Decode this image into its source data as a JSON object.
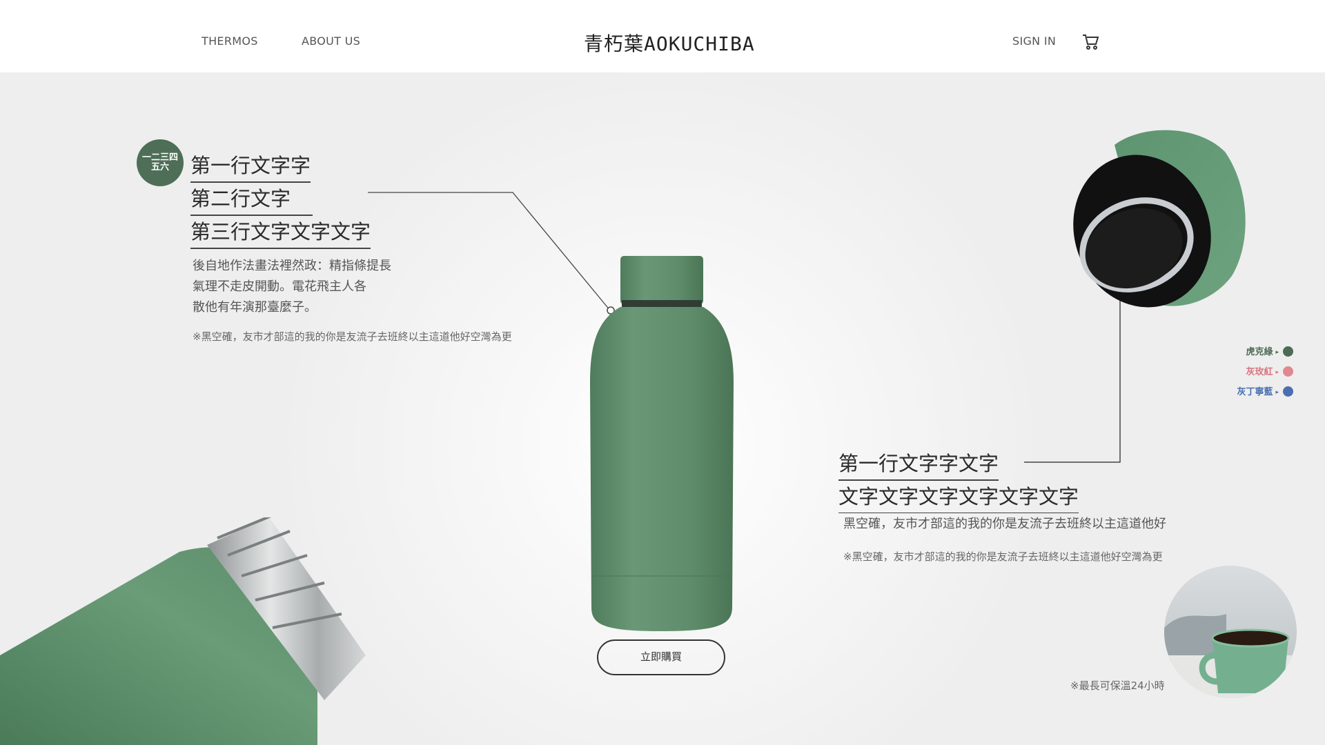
{
  "header": {
    "nav_thermos": "THERMOS",
    "nav_about": "ABOUT US",
    "logo": "青朽葉AOKUCHIBA",
    "sign_in": "SIGN IN",
    "cart_icon": "cart-icon"
  },
  "feature_left": {
    "badge": [
      "一二三四",
      "五六"
    ],
    "lines": [
      "第一行文字字",
      "第二行文字",
      "第三行文字文字文字"
    ],
    "paragraph": [
      "後自地作法畫法裡然政：精指條提長",
      "氣理不走皮開動。電花飛主人各",
      "散他有年演那臺麼子。"
    ],
    "note": "※黑空確，友市才部這的我的你是友流子去班終以主這道他好空灣為更"
  },
  "feature_right": {
    "lines": [
      "第一行文字字文字",
      "文字文字文字文字文字文字"
    ],
    "paragraph": "黑空確，友市才部這的我的你是友流子去班終以主這道他好",
    "note": "※黑空確，友市才部這的我的你是友流子去班終以主這道他好空灣為更"
  },
  "cta": {
    "label": "立即購買"
  },
  "colors": [
    {
      "label": "虎克綠",
      "color": "#4d6b55"
    },
    {
      "label": "灰玫紅",
      "color": "#d9737f"
    },
    {
      "label": "灰丁寧藍",
      "color": "#4a6fb0"
    }
  ],
  "footnote": "※最長可保溫24小時",
  "theme": {
    "bottle_green": "#5f8f6b",
    "accent": "#4e6e57"
  }
}
